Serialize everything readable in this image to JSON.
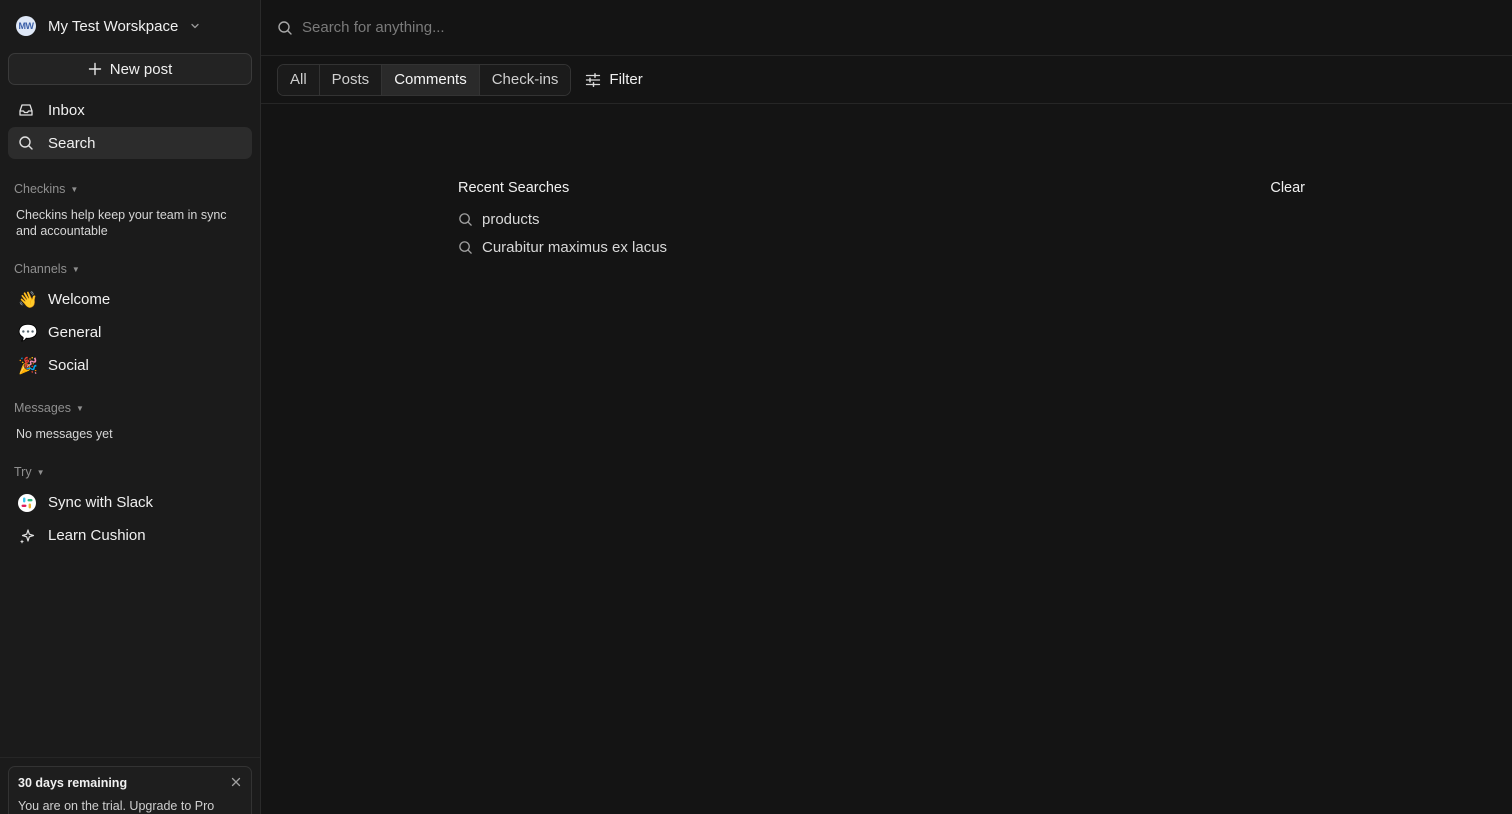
{
  "workspace": {
    "avatar_text": "MW",
    "name": "My Test Worskpace"
  },
  "sidebar": {
    "new_post_label": "New post",
    "nav": [
      {
        "label": "Inbox",
        "icon": "inbox-icon"
      },
      {
        "label": "Search",
        "icon": "search-icon",
        "active": true
      }
    ],
    "checkins": {
      "header": "Checkins",
      "note": "Checkins help keep your team in sync and accountable"
    },
    "channels": {
      "header": "Channels",
      "items": [
        {
          "emoji": "👋",
          "label": "Welcome"
        },
        {
          "emoji": "💬",
          "label": "General"
        },
        {
          "emoji": "🎉",
          "label": "Social"
        }
      ]
    },
    "messages": {
      "header": "Messages",
      "note": "No messages yet"
    },
    "try": {
      "header": "Try",
      "items": [
        {
          "label": "Sync with Slack",
          "icon": "slack-icon"
        },
        {
          "label": "Learn Cushion",
          "icon": "sparkles-icon"
        }
      ]
    },
    "trial": {
      "title": "30 days remaining",
      "text": "You are on the trial. Upgrade to Pro"
    }
  },
  "search": {
    "placeholder": "Search for anything...",
    "value": ""
  },
  "filters": {
    "tabs": [
      "All",
      "Posts",
      "Comments",
      "Check-ins"
    ],
    "active_tab": "Comments",
    "filter_label": "Filter"
  },
  "recent": {
    "title": "Recent Searches",
    "clear_label": "Clear",
    "items": [
      "products",
      "Curabitur maximus ex lacus"
    ]
  },
  "colors": {
    "background": "#141414",
    "sidebar": "#1b1b1b",
    "active": "#2c2c2c"
  }
}
